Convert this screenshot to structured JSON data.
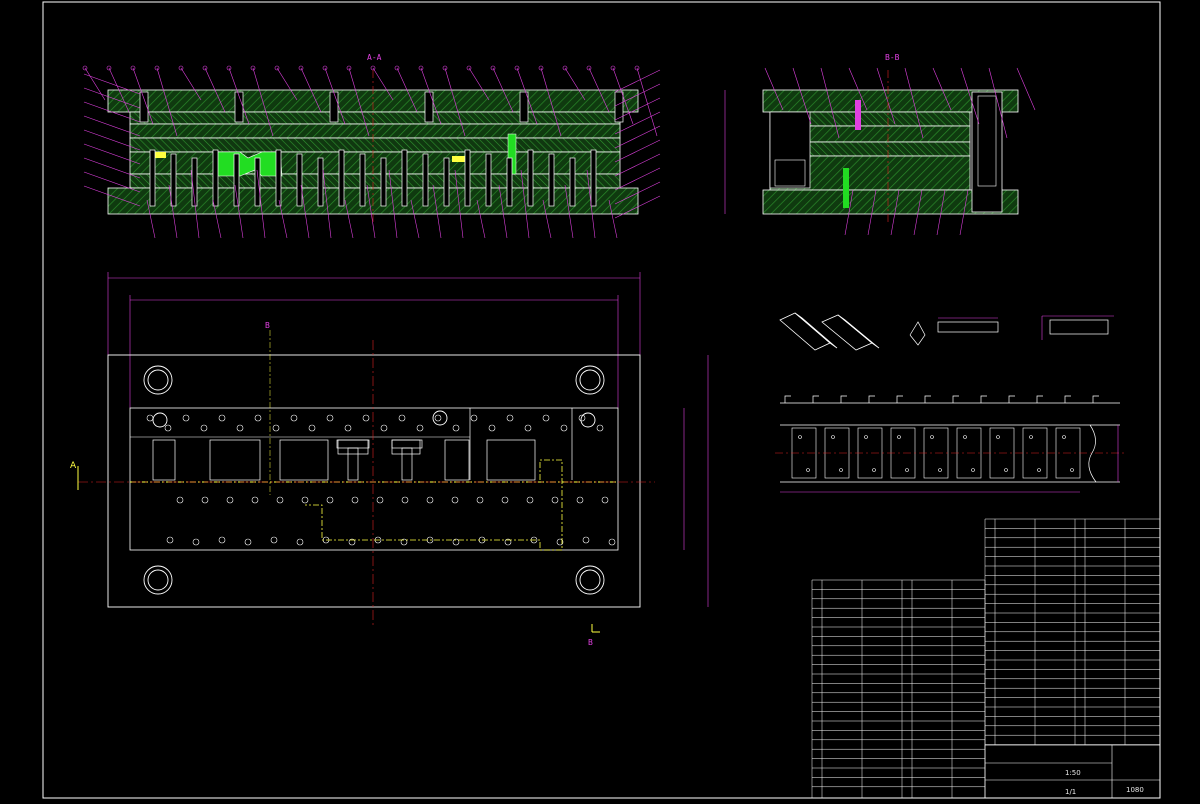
{
  "drawing": {
    "title_main": "",
    "section_aa": "A-A",
    "section_bb": "B-B",
    "view_marks": [
      "B",
      "A",
      "B"
    ],
    "scale": "1:50",
    "sheet_no": "1/1"
  },
  "colors": {
    "background": "#000000",
    "outline": "#ffffff",
    "hatch": "#1f6e1f",
    "part": "#22dd22",
    "leader": "#e040e0",
    "centerline": "#dd2222",
    "dim": "#e040e0",
    "yellow": "#ffff40"
  },
  "notes": {
    "heading": "",
    "lines": [
      "",
      "",
      "",
      "",
      ""
    ]
  },
  "bom": {
    "header": [
      "",
      "",
      "",
      "",
      ""
    ],
    "rows": []
  },
  "title_block": {
    "company": "",
    "drawing_name": "",
    "code": "1080"
  }
}
